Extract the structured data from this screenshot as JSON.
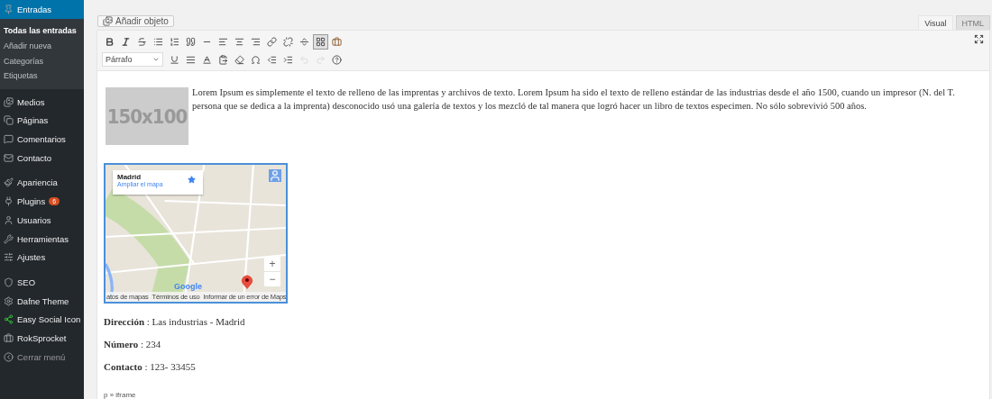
{
  "sidebar": {
    "items": [
      {
        "label": "Entradas",
        "selected": true,
        "children": [
          {
            "label": "Todas las entradas",
            "selected": true
          },
          {
            "label": "Añadir nueva",
            "selected": false
          },
          {
            "label": "Categorías",
            "selected": false
          },
          {
            "label": "Etiquetas",
            "selected": false
          }
        ]
      },
      {
        "label": "Medios",
        "selected": false
      },
      {
        "label": "Páginas",
        "selected": false
      },
      {
        "label": "Comentarios",
        "selected": false
      },
      {
        "label": "Contacto",
        "selected": false
      },
      {
        "label": "Apariencia",
        "selected": false
      },
      {
        "label": "Plugins",
        "selected": false,
        "badge": "6"
      },
      {
        "label": "Usuarios",
        "selected": false
      },
      {
        "label": "Herramientas",
        "selected": false
      },
      {
        "label": "Ajustes",
        "selected": false
      },
      {
        "label": "SEO",
        "selected": false
      },
      {
        "label": "Dafne Theme",
        "selected": false
      },
      {
        "label": "Easy Social Icon",
        "selected": false
      },
      {
        "label": "RokSprocket",
        "selected": false
      }
    ],
    "collapse": "Cerrar menú"
  },
  "add_media_button": "Añadir objeto",
  "editor_tabs": [
    {
      "label": "Visual",
      "selected": true
    },
    {
      "label": "HTML",
      "selected": false
    }
  ],
  "toolbar": {
    "row_1": [
      {
        "pressed": false
      },
      {
        "pressed": false
      },
      {
        "pressed": false
      },
      {
        "pressed": false
      },
      {
        "pressed": false
      },
      {
        "pressed": false
      },
      {
        "pressed": false
      },
      {
        "pressed": false
      },
      {
        "pressed": false
      },
      {
        "pressed": false
      },
      {
        "pressed": false
      },
      {
        "pressed": false
      },
      {
        "pressed": false
      },
      {
        "pressed": true
      },
      {
        "pressed": false
      }
    ],
    "format_select": "Párrafo",
    "row_2": [
      {
        "disabled": false
      },
      {
        "disabled": false
      },
      {
        "disabled": false
      },
      {
        "disabled": false
      },
      {
        "disabled": false
      },
      {
        "disabled": false
      },
      {
        "disabled": false
      },
      {
        "disabled": false
      },
      {
        "disabled": true
      },
      {
        "disabled": true
      },
      {
        "disabled": false
      }
    ]
  },
  "content": {
    "image_placeholder": "150x100",
    "paragraph": "Lorem Ipsum es simplemente el texto de relleno de las imprentas y archivos de texto. Lorem Ipsum ha sido el texto de relleno estándar de las industrias desde el año 1500, cuando un impresor (N. del T. persona que se dedica a la imprenta) desconocido usó una galería de textos y los mezcló de tal manera que logró hacer un libro de textos especimen. No sólo sobrevivió 500 años.",
    "map": {
      "place": "Madrid",
      "link": "Ampliar el mapa",
      "logo": "Google",
      "zoom_in": "+",
      "zoom_out": "−",
      "footer": [
        "atos de mapas",
        "Términos de uso",
        "Informar de un error de Maps"
      ]
    },
    "details": [
      "**Dirección** : Las industrias - Madrid",
      "**Número** : 234",
      "**Contacto** : 123- 33455"
    ]
  },
  "path": "p » iframe"
}
